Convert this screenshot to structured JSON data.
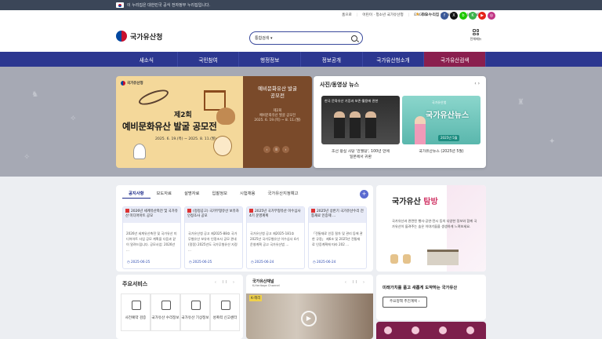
{
  "gov_banner": {
    "text": "이 누리집은 대한민국 공식 전자정부 누리집입니다."
  },
  "utility": {
    "links": [
      "홈으로",
      "어린이 · 청소년 국가유산청",
      "ENGLISH",
      "CHINESE",
      "JAPANESE"
    ],
    "favorite": "주요 누리집",
    "socials": [
      {
        "icon": "facebook-icon",
        "color": "#3b5998",
        "glyph": "f"
      },
      {
        "icon": "x-icon",
        "color": "#111111",
        "glyph": "X"
      },
      {
        "icon": "blog-icon",
        "color": "#1ec800",
        "glyph": "b"
      },
      {
        "icon": "kakao-icon",
        "color": "#3ab24a",
        "glyph": "K"
      },
      {
        "icon": "youtube-icon",
        "color": "#e62117",
        "glyph": "▶"
      },
      {
        "icon": "instagram-icon",
        "color": "#c13584",
        "glyph": "◎"
      }
    ]
  },
  "header": {
    "logo": "국가유산청",
    "search_select": "통합검색",
    "search_placeholder": "",
    "allmenu": "전체메뉴"
  },
  "gnb": [
    "새소식",
    "국민참여",
    "행정정보",
    "정보공개",
    "국가유산청소개",
    "국가유산검색"
  ],
  "gnb_active": 5,
  "banner": {
    "brand": "국가유산청",
    "edition": "제2회",
    "title": "예비문화유산 발굴 공모전",
    "date": "2025. 6. 19.(목) ~ 2025. 8. 11.(월)"
  },
  "banner_side": {
    "title_line1": "예비문화유산 발굴",
    "title_line2": "공모전",
    "sub1": "제2회",
    "sub2": "예비문화유산 발굴 공모전",
    "sub3": "2025. 6. 19.(목) ~ 8. 11.(월)",
    "pager": [
      "‹",
      "II",
      "›"
    ]
  },
  "news": {
    "title": "사진/동영상 뉴스",
    "arrows": "‹ ›",
    "cards": [
      {
        "overlay": "한국 문화유산 기증과 보존·활용에 관한",
        "caption_1": "조선 왕실 사당 '관월당', 100년 만에",
        "caption_2": "일본에서 귀환"
      },
      {
        "channel": "국가유산청",
        "headline": "국가유산뉴스",
        "badge": "2025년 5월",
        "caption_1": "국가유산뉴스 (2025년 5월)",
        "caption_2": ""
      }
    ]
  },
  "notice": {
    "tabs": [
      "공지사항",
      "보도자료",
      "설명자료",
      "입찰정보",
      "시험채용",
      "국가유산지정예고"
    ],
    "plus": "+",
    "cards": [
      {
        "title": "2026년 세계유산축전 및 국가유산 미디어아트 공모",
        "body": "2026년 세계유산축전 및 국가유산 미디어아트 사업 공모 계획을 다음과 같이 알려드립니다. 공모사업: 2026년 ...",
        "date": "2025-06-25"
      },
      {
        "title": "(정정공고) 국가무형유산 보유자 인정조사 공모",
        "body": "국가유산청 공고 제2025-88호 국가무형유산 보유자 인정조사 공모 관내(정정) 2025년도 국가무형유산 지정 ...",
        "date": "2025-06-25"
      },
      {
        "title": "2025년 국가무형유산 이수심사 4기 운영계획",
        "body": "국가유산청 공고 제2025-181호 2025년 국가무형유산 이수심사 4기 운영계획 공고 국가유산법 ...",
        "date": "2025-06-24"
      },
      {
        "title": "2025년 상반기 국가유산수리 전통재료 인증제 ...",
        "body": "「전통재료 인증 절차 및 관리 등에 관한 규정」 제6조 및 2025년 전통재료 인증계획에 따라 202 ...",
        "date": "2025-06-24"
      }
    ]
  },
  "tambang": {
    "title_a": "국가유산",
    "title_b": "탐방",
    "desc": "국가유산과 관련된 행사·공연·전시 등의 다양한 정보와 함께 국가유산이 들려주는 숨은 이야기들을 생생하게 느껴보세요."
  },
  "services": {
    "title": "주요서비스",
    "ctrl": "‹ II ›",
    "items": [
      "사전예약 검증",
      "국가유산 수리정보",
      "국가유산 기상정보",
      "성폭력 신고센터"
    ]
  },
  "channel": {
    "title": "국가유산채널",
    "sub": "K-Heritage Channel",
    "ctrl": "‹ II ›",
    "tag": "K-헤리",
    "play": "▶"
  },
  "promo": {
    "title": "미래가치를 품고 새롭게 도약하는 국가유산",
    "button": "주요정책 추진계획 ›"
  }
}
